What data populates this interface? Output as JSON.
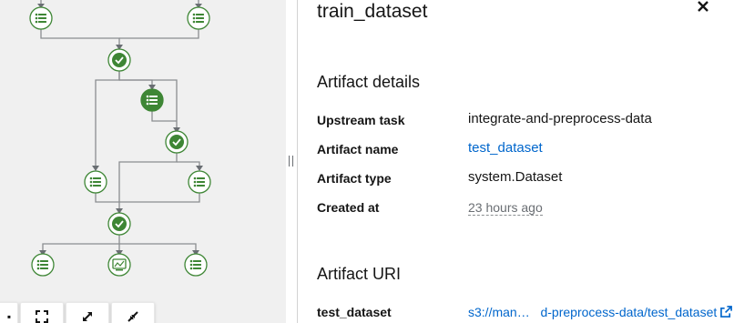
{
  "drawer": {
    "title": "train_dataset",
    "close_icon": "close-icon",
    "artifact_details": {
      "heading": "Artifact details",
      "rows": [
        {
          "label": "Upstream task",
          "value": "integrate-and-preprocess-data"
        },
        {
          "label": "Artifact name",
          "value": "test_dataset"
        },
        {
          "label": "Artifact type",
          "value": "system.Dataset"
        },
        {
          "label": "Created at",
          "value": "23 hours ago"
        }
      ]
    },
    "artifact_uri": {
      "heading": "Artifact URI",
      "label": "test_dataset",
      "value_start": "s3://man…",
      "value_end": "d-preprocess-data/test_dataset",
      "external_link_icon": "external-link-icon"
    }
  },
  "graph": {
    "toolbar": [
      {
        "name": "zoom-in-button",
        "icon": "zoom-in-icon"
      },
      {
        "name": "fit-to-screen-button",
        "icon": "fit-screen-icon"
      },
      {
        "name": "expand-button",
        "icon": "expand-icon"
      },
      {
        "name": "collapse-button",
        "icon": "collapse-icon"
      }
    ],
    "colors": {
      "success": "#3e8635",
      "edge": "#8a8d90",
      "node_border": "#3e8635"
    }
  }
}
